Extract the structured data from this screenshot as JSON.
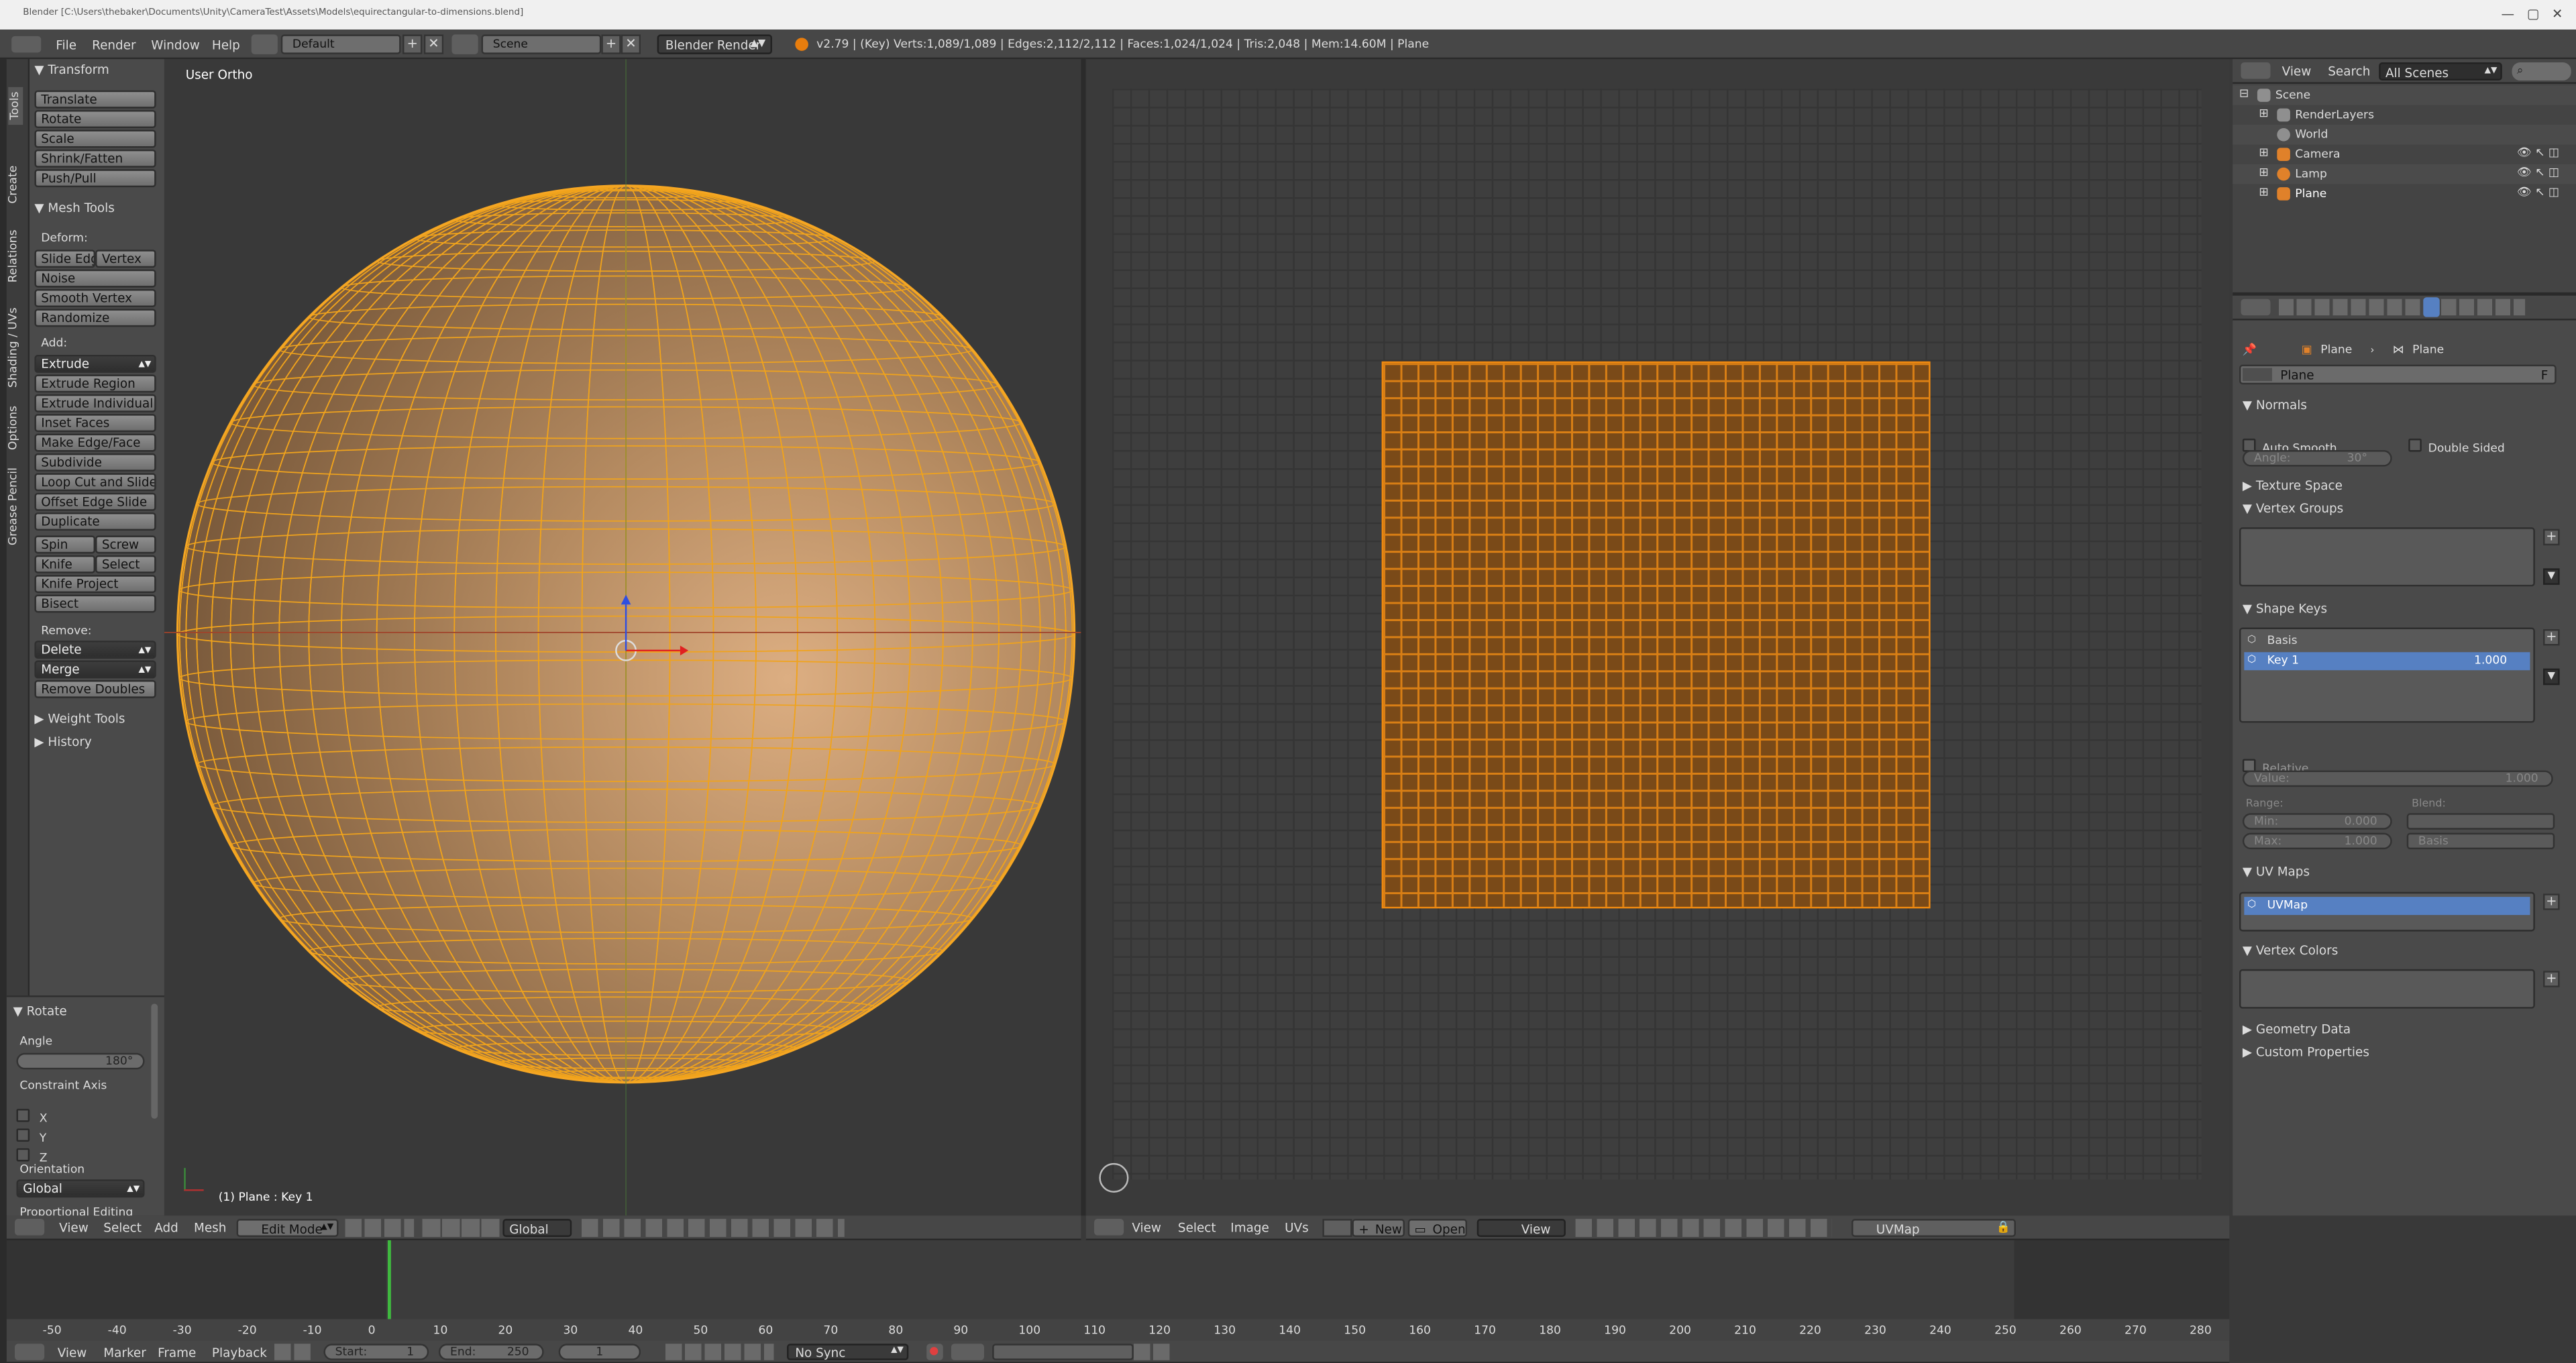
{
  "window": {
    "title": "Blender [C:\\Users\\thebaker\\Documents\\Unity\\CameraTest\\Assets\\Models\\equirectangular-to-dimensions.blend]"
  },
  "infobar": {
    "menus": [
      "File",
      "Render",
      "Window",
      "Help"
    ],
    "layout": "Default",
    "scene": "Scene",
    "engine": "Blender Render",
    "stats": "v2.79 | (Key) Verts:1,089/1,089 | Edges:2,112/2,112 | Faces:1,024/1,024 | Tris:2,048 | Mem:14.60M | Plane"
  },
  "toolshelf": {
    "tabs": [
      "Tools",
      "Create",
      "Relations",
      "Shading / UVs",
      "Options",
      "Grease Pencil"
    ],
    "transform": {
      "title": "Transform",
      "buttons": [
        "Translate",
        "Rotate",
        "Scale",
        "Shrink/Fatten",
        "Push/Pull"
      ]
    },
    "mesh_tools": {
      "title": "Mesh Tools",
      "deform_label": "Deform:",
      "slide_edge": "Slide Edg",
      "vertex": "Vertex",
      "noise": "Noise",
      "smooth_vertex": "Smooth Vertex",
      "randomize": "Randomize",
      "add_label": "Add:",
      "extrude": "Extrude",
      "add_buttons": [
        "Extrude Region",
        "Extrude Individual",
        "Inset Faces",
        "Make Edge/Face",
        "Subdivide",
        "Loop Cut and Slide",
        "Offset Edge Slide",
        "Duplicate"
      ],
      "spin": "Spin",
      "screw": "Screw",
      "knife": "Knife",
      "select": "Select",
      "knife_project": "Knife Project",
      "bisect": "Bisect",
      "remove_label": "Remove:",
      "delete": "Delete",
      "merge": "Merge",
      "remove_doubles": "Remove Doubles"
    },
    "weight_tools": "Weight Tools",
    "history": "History"
  },
  "operator": {
    "title": "Rotate",
    "angle_label": "Angle",
    "angle_value": "180°",
    "constraint_label": "Constraint Axis",
    "axes": [
      "X",
      "Y",
      "Z"
    ],
    "orientation_label": "Orientation",
    "orientation_value": "Global",
    "proportional": "Proportional Editing"
  },
  "viewport": {
    "view_name": "User Ortho",
    "object_info": "(1) Plane : Key 1",
    "menus": [
      "View",
      "Select",
      "Add",
      "Mesh"
    ],
    "mode": "Edit Mode",
    "orientation": "Global"
  },
  "uv_editor": {
    "menus": [
      "View",
      "Select",
      "Image",
      "UVs"
    ],
    "new": "New",
    "open": "Open",
    "view": "View",
    "uvmap": "UVMap"
  },
  "outliner": {
    "menus": [
      "View",
      "Search"
    ],
    "scenes": "All Scenes",
    "items": [
      "Scene",
      "RenderLayers",
      "World",
      "Camera",
      "Lamp",
      "Plane"
    ]
  },
  "properties": {
    "breadcrumb": [
      "Plane",
      "Plane"
    ],
    "mesh_name": "Plane",
    "fake_user": "F",
    "normals": {
      "title": "Normals",
      "auto_smooth": "Auto Smooth",
      "double_sided": "Double Sided",
      "angle_label": "Angle:",
      "angle_value": "30°"
    },
    "texture_space": "Texture Space",
    "vertex_groups": "Vertex Groups",
    "shape_keys": {
      "title": "Shape Keys",
      "basis": "Basis",
      "key1": "Key 1",
      "key1_value": "1.000",
      "relative": "Relative",
      "value_label": "Value:",
      "value": "1.000",
      "range_label": "Range:",
      "blend_label": "Blend:",
      "min_label": "Min:",
      "min_value": "0.000",
      "max_label": "Max:",
      "max_value": "1.000",
      "blend_value": "Basis"
    },
    "uv_maps": {
      "title": "UV Maps",
      "item": "UVMap"
    },
    "vertex_colors": "Vertex Colors",
    "geometry_data": "Geometry Data",
    "custom_properties": "Custom Properties"
  },
  "timeline": {
    "ticks": [
      "-50",
      "-40",
      "-30",
      "-20",
      "-10",
      "0",
      "10",
      "20",
      "30",
      "40",
      "50",
      "60",
      "70",
      "80",
      "90",
      "100",
      "110",
      "120",
      "130",
      "140",
      "150",
      "160",
      "170",
      "180",
      "190",
      "200",
      "210",
      "220",
      "230",
      "240",
      "250",
      "260",
      "270",
      "280"
    ],
    "menus": [
      "View",
      "Marker",
      "Frame",
      "Playback"
    ],
    "start_label": "Start:",
    "start": "1",
    "end_label": "End:",
    "end": "250",
    "current": "1",
    "sync": "No Sync"
  },
  "colors": {
    "accent": "#5680c2",
    "selection": "#e89a1c",
    "background": "#393939"
  }
}
